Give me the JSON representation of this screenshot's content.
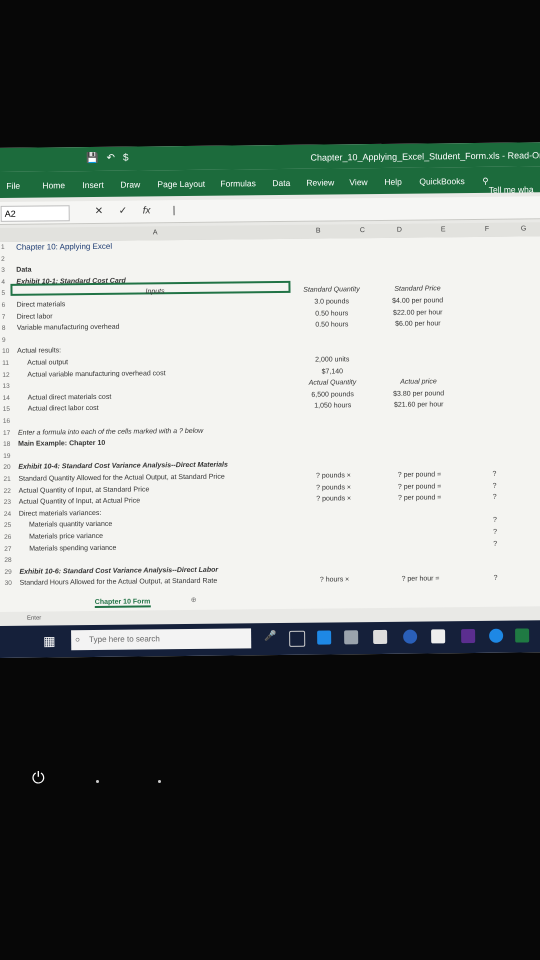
{
  "window": {
    "title": "Chapter_10_Applying_Excel_Student_Form.xls - Read-On"
  },
  "menu": [
    "File",
    "Home",
    "Insert",
    "Draw",
    "Page Layout",
    "Formulas",
    "Data",
    "Review",
    "View",
    "Help",
    "QuickBooks"
  ],
  "tell_me": "Tell me wha",
  "formula_bar": {
    "name_box": "A2",
    "fx": "fx",
    "value": "|"
  },
  "columns": [
    "A",
    "B",
    "C",
    "D",
    "E",
    "F",
    "G"
  ],
  "rows": [
    {
      "n": "1",
      "a": "Chapter 10: Applying Excel",
      "c": "",
      "d": "",
      "q": ""
    },
    {
      "n": "2",
      "a": "",
      "c": "",
      "d": "",
      "q": ""
    },
    {
      "n": "3",
      "a": "Data",
      "c": "",
      "d": "",
      "q": ""
    },
    {
      "n": "4",
      "a": "Exhibit 10-1: Standard Cost Card",
      "c": "",
      "d": "",
      "q": ""
    },
    {
      "n": "5",
      "a": "Inputs",
      "c": "Standard Quantity",
      "d": "Standard Price",
      "q": ""
    },
    {
      "n": "6",
      "a": "Direct materials",
      "c": "3.0 pounds",
      "d": "$4.00 per pound",
      "q": ""
    },
    {
      "n": "7",
      "a": "Direct labor",
      "c": "0.50 hours",
      "d": "$22.00 per hour",
      "q": ""
    },
    {
      "n": "8",
      "a": "Variable manufacturing overhead",
      "c": "0.50 hours",
      "d": "$6.00 per hour",
      "q": ""
    },
    {
      "n": "9",
      "a": "",
      "c": "",
      "d": "",
      "q": ""
    },
    {
      "n": "10",
      "a": "Actual results:",
      "c": "",
      "d": "",
      "q": ""
    },
    {
      "n": "11",
      "a": "Actual output",
      "c": "2,000 units",
      "d": "",
      "q": ""
    },
    {
      "n": "12",
      "a": "Actual variable manufacturing overhead cost",
      "c": "$7,140",
      "d": "",
      "q": ""
    },
    {
      "n": "13",
      "a": "",
      "c": "Actual Quantity",
      "d": "Actual price",
      "q": ""
    },
    {
      "n": "14",
      "a": "Actual direct materials cost",
      "c": "6,500 pounds",
      "d": "$3.80 per pound",
      "q": ""
    },
    {
      "n": "15",
      "a": "Actual direct labor cost",
      "c": "1,050 hours",
      "d": "$21.60 per hour",
      "q": ""
    },
    {
      "n": "16",
      "a": "",
      "c": "",
      "d": "",
      "q": ""
    },
    {
      "n": "17",
      "a": "Enter a formula into each of the cells marked with a ? below",
      "c": "",
      "d": "",
      "q": ""
    },
    {
      "n": "18",
      "a": "Main Example: Chapter 10",
      "c": "",
      "d": "",
      "q": ""
    },
    {
      "n": "19",
      "a": "",
      "c": "",
      "d": "",
      "q": ""
    },
    {
      "n": "20",
      "a": "Exhibit 10-4: Standard Cost Variance Analysis--Direct Materials",
      "c": "",
      "d": "",
      "q": ""
    },
    {
      "n": "21",
      "a": "Standard Quantity Allowed for the Actual Output, at Standard Price",
      "c": "? pounds ×",
      "d": "? per pound =",
      "q": "?"
    },
    {
      "n": "22",
      "a": "Actual Quantity of Input, at Standard Price",
      "c": "? pounds ×",
      "d": "? per pound =",
      "q": "?"
    },
    {
      "n": "23",
      "a": "Actual Quantity of Input, at Actual Price",
      "c": "? pounds ×",
      "d": "? per pound =",
      "q": "?"
    },
    {
      "n": "24",
      "a": "Direct materials variances:",
      "c": "",
      "d": "",
      "q": ""
    },
    {
      "n": "25",
      "a": "Materials quantity variance",
      "c": "",
      "d": "",
      "q": "?"
    },
    {
      "n": "26",
      "a": "Materials price variance",
      "c": "",
      "d": "",
      "q": "?"
    },
    {
      "n": "27",
      "a": "Materials spending variance",
      "c": "",
      "d": "",
      "q": "?"
    },
    {
      "n": "28",
      "a": "",
      "c": "",
      "d": "",
      "q": ""
    },
    {
      "n": "29",
      "a": "Exhibit 10-6: Standard Cost Variance Analysis--Direct Labor",
      "c": "",
      "d": "",
      "q": ""
    },
    {
      "n": "30",
      "a": "Standard Hours Allowed for the Actual Output, at Standard Rate",
      "c": "? hours ×",
      "d": "? per hour =",
      "q": "?"
    }
  ],
  "sheet_tab": "Chapter 10 Form",
  "status": "Enter",
  "taskbar": {
    "search_placeholder": "Type here to search"
  }
}
